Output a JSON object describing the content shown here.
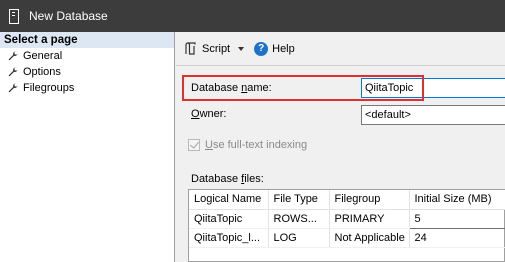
{
  "window": {
    "title": "New Database"
  },
  "sidebar": {
    "header": "Select a page",
    "items": [
      {
        "label": "General"
      },
      {
        "label": "Options"
      },
      {
        "label": "Filegroups"
      }
    ]
  },
  "toolbar": {
    "script_label": "Script",
    "help_label": "Help"
  },
  "form": {
    "database_name_label_prefix": "Database ",
    "database_name_label_underline": "n",
    "database_name_label_suffix": "ame:",
    "database_name_value": "QiitaTopic",
    "owner_label_underline": "O",
    "owner_label_suffix": "wner:",
    "owner_value": "<default>",
    "fulltext_label_underline": "U",
    "fulltext_label_suffix": "se full-text indexing",
    "fulltext_checked": true,
    "files_label_prefix": "Database ",
    "files_label_underline": "f",
    "files_label_suffix": "iles:"
  },
  "files_grid": {
    "columns": [
      "Logical Name",
      "File Type",
      "Filegroup",
      "Initial Size (MB)"
    ],
    "rows": [
      {
        "logical_name": "QiitaTopic",
        "file_type": "ROWS...",
        "filegroup": "PRIMARY",
        "initial_size": "5"
      },
      {
        "logical_name": "QiitaTopic_l...",
        "file_type": "LOG",
        "filegroup": "Not Applicable",
        "initial_size": "24"
      }
    ]
  }
}
